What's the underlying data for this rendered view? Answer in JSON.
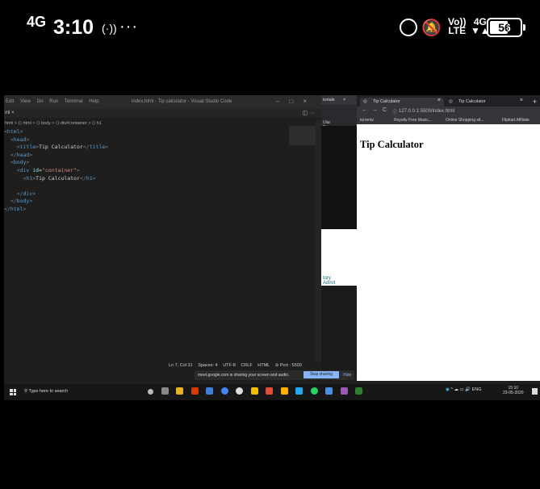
{
  "phone_status": {
    "signal": "4G",
    "time": "3:10",
    "hotspot_glyph": "(·))",
    "dots": "···",
    "volte_top": "Vo))",
    "volte_bottom": "LTE",
    "net_top": "4G",
    "net_bottom": "▼▲",
    "battery": "56"
  },
  "vscode": {
    "menu": [
      "Edit",
      "View",
      "Go",
      "Run",
      "Terminal",
      "Help"
    ],
    "window_title": "index.html - Tip calculator - Visual Studio Code",
    "tab_label": "ml ×",
    "breadcrumb": "html > ⟨⟩ html > ⟨⟩ body > ⟨⟩ div#container > ⟨⟩ h1",
    "code_lines": [
      {
        "indent": "",
        "parts": [
          [
            "br",
            "<"
          ],
          [
            "tg",
            "html"
          ],
          [
            "br",
            ">"
          ]
        ]
      },
      {
        "indent": "  ",
        "parts": [
          [
            "br",
            "<"
          ],
          [
            "tg",
            "head"
          ],
          [
            "br",
            ">"
          ]
        ]
      },
      {
        "indent": "    ",
        "parts": [
          [
            "br",
            "<"
          ],
          [
            "tg",
            "title"
          ],
          [
            "br",
            ">"
          ],
          [
            "tx",
            "Tip Calculator"
          ],
          [
            "br",
            "</"
          ],
          [
            "tg",
            "title"
          ],
          [
            "br",
            ">"
          ]
        ]
      },
      {
        "indent": "  ",
        "parts": [
          [
            "br",
            "</"
          ],
          [
            "tg",
            "head"
          ],
          [
            "br",
            ">"
          ]
        ]
      },
      {
        "indent": "  ",
        "parts": [
          [
            "br",
            "<"
          ],
          [
            "tg",
            "body"
          ],
          [
            "br",
            ">"
          ]
        ]
      },
      {
        "indent": "    ",
        "parts": [
          [
            "br",
            "<"
          ],
          [
            "tg",
            "div "
          ],
          [
            "at",
            "id"
          ],
          [
            "tx",
            "="
          ],
          [
            "st",
            "\"container\""
          ],
          [
            "br",
            ">"
          ]
        ]
      },
      {
        "indent": "      ",
        "parts": [
          [
            "br",
            "<"
          ],
          [
            "tg",
            "h1"
          ],
          [
            "br",
            ">"
          ],
          [
            "tx",
            "Tip Calculator"
          ],
          [
            "br",
            "</"
          ],
          [
            "tg",
            "h1"
          ],
          [
            "br",
            ">"
          ]
        ]
      },
      {
        "indent": "",
        "parts": []
      },
      {
        "indent": "    ",
        "parts": [
          [
            "br",
            "</"
          ],
          [
            "tg",
            "div"
          ],
          [
            "br",
            ">"
          ]
        ]
      },
      {
        "indent": "  ",
        "parts": [
          [
            "br",
            "</"
          ],
          [
            "tg",
            "body"
          ],
          [
            "br",
            ">"
          ]
        ]
      },
      {
        "indent": "",
        "parts": [
          [
            "br",
            "</"
          ],
          [
            "tg",
            "html"
          ],
          [
            "br",
            ">"
          ]
        ]
      }
    ],
    "status": [
      "Ln 7, Col 31",
      "Spaces: 4",
      "UTF-8",
      "CRLF",
      "HTML",
      "⊘ Port : 5500"
    ]
  },
  "middle_window": {
    "tab": "torials",
    "bookmark": "Ular Programmer...",
    "links": [
      "tory",
      "Admit"
    ]
  },
  "chrome": {
    "tabs": [
      {
        "label": "Tip Calculator"
      },
      {
        "label": "Tip Calculator"
      }
    ],
    "url": "127.0.0.1:5500/index.html",
    "bookmarks": [
      "torrentz",
      "Royalty Free Music...",
      "Online Shopping sit...",
      "Flipkart Affiliate"
    ],
    "heading": "Tip Calculator"
  },
  "share_bar": {
    "message": "meet.google.com is sharing your screen and audio.",
    "stop_label": "Stop sharing",
    "hide_label": "Hide"
  },
  "taskbar": {
    "search_placeholder": "Type here to search",
    "tray_lang": "ENG",
    "clock_time": "15:10",
    "clock_date": "23-05-2020"
  },
  "colors": {
    "vscode_bg": "#1e1e1e",
    "tag": "#569cd6",
    "string": "#ce9178",
    "attr": "#9cdcfe",
    "stop_sharing": "#8ab4f8"
  }
}
